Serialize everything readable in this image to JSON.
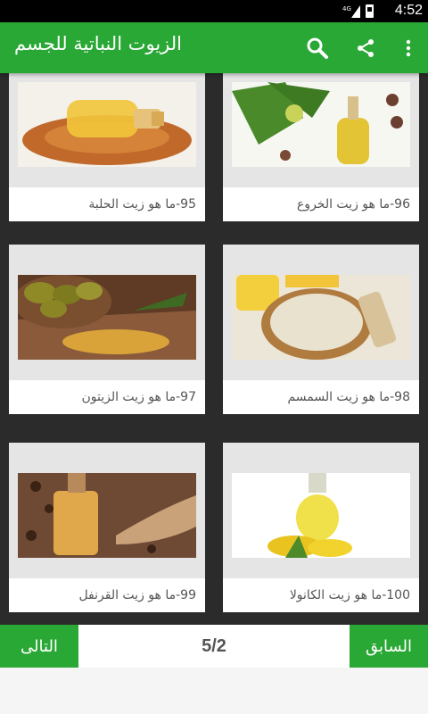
{
  "status": {
    "time": "4:52",
    "network": "4G"
  },
  "app_bar": {
    "title": "الزيوت النباتية للجسم",
    "icons": [
      "search-icon",
      "share-icon",
      "more-vert-icon"
    ]
  },
  "items": [
    {
      "label": "95-ما هو زيت الحلبة",
      "image": "fenugreek-oil"
    },
    {
      "label": "96-ما هو زيت الخروع",
      "image": "castor-oil"
    },
    {
      "label": "97-ما هو زيت الزيتون",
      "image": "olive-oil"
    },
    {
      "label": "98-ما هو زيت السمسم",
      "image": "sesame-oil"
    },
    {
      "label": "99-ما هو زيت القرنفل",
      "image": "clove-oil"
    },
    {
      "label": "100-ما هو زيت الكانولا",
      "image": "canola-oil"
    }
  ],
  "pager": {
    "prev_label": "السابق",
    "next_label": "التالى",
    "page": "5/2"
  },
  "colors": {
    "primary": "#2aa836",
    "grid_bg": "#2b2b2b",
    "card_bg": "#e5e5e5"
  }
}
